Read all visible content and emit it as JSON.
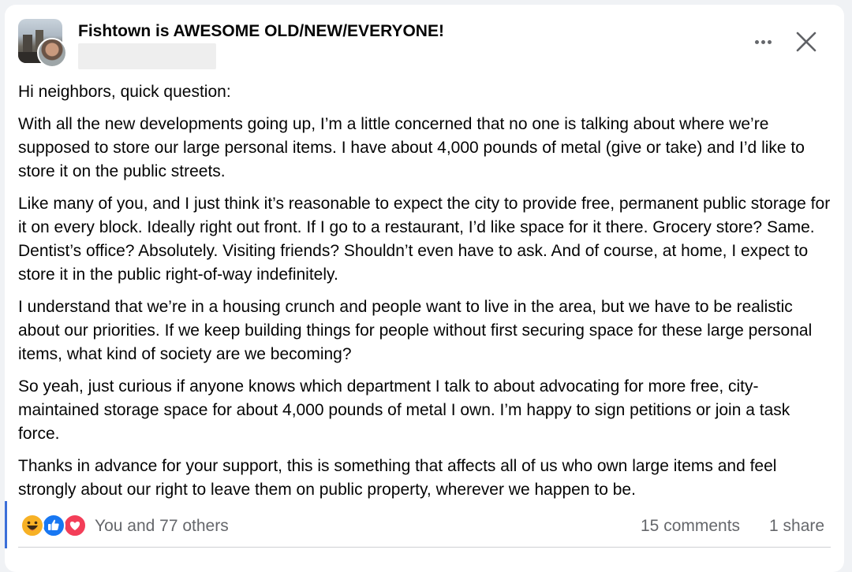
{
  "group": {
    "name": "Fishtown is AWESOME OLD/NEW/EVERYONE!"
  },
  "icons": {
    "more": "more-horizontal-icon",
    "close": "close-icon",
    "reactions": [
      "haha-reaction-icon",
      "like-reaction-icon",
      "love-reaction-icon"
    ]
  },
  "colors": {
    "like_blue": "#1877f2",
    "love_red": "#f33e58",
    "haha_yellow": "#f7b125",
    "secondary_text": "#65676b"
  },
  "post": {
    "paragraphs": [
      "Hi neighbors, quick question:",
      "With all the new developments going up, I’m a little concerned that no one is talking about where we’re supposed to store our large personal items. I have about 4,000 pounds of metal (give or take) and I’d like to store it on the public streets.",
      "Like many of you, and I just think it’s reasonable to expect the city to provide free, permanent public storage for it on every block. Ideally right out front. If I go to a restaurant, I’d like space for it there. Grocery store? Same. Dentist’s office? Absolutely. Visiting friends? Shouldn’t even have to ask. And of course, at home, I expect to store it in the public right-of-way indefinitely.",
      "I understand that we’re in a housing crunch and people want to live in the area, but we have to be realistic about our priorities. If we keep building things for people without first securing space for these large personal items, what kind of society are we becoming?",
      "So yeah, just curious if anyone knows which department I talk to about advocating for more free, city-maintained storage space for about 4,000 pounds of metal I own. I’m happy to sign petitions or join a task force.",
      "Thanks in advance for your support, this is something that affects all of us who own large items and feel strongly about our right to leave them on public property, wherever we happen to be."
    ]
  },
  "engagement": {
    "reactions_text": "You and 77 others",
    "comments_text": "15 comments",
    "shares_text": "1 share"
  }
}
